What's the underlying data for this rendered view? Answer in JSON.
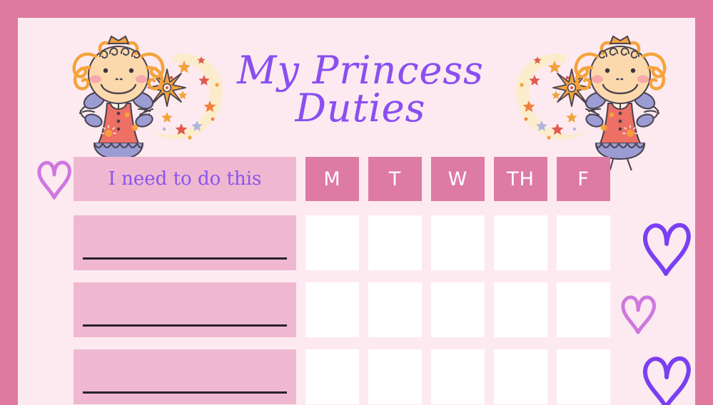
{
  "page": {
    "title_line1": "My Princess",
    "title_line2": "Duties",
    "border_color": "#e0799f",
    "background_color": "#fdeaf0"
  },
  "table": {
    "task_column_header": "I need to do this",
    "task_header_bg": "#efb8d0",
    "task_header_text_color": "#8855ee",
    "day_header_bg": "#dd7ba5",
    "day_header_text_color": "#ffffff",
    "row_bg": "#efb8d0",
    "cell_bg": "#ffffff",
    "day_headers": [
      {
        "label": "M"
      },
      {
        "label": "T"
      },
      {
        "label": "W"
      },
      {
        "label": "TH"
      },
      {
        "label": "F"
      }
    ],
    "rows": [
      {
        "task": "",
        "checks": [
          "",
          "",
          "",
          "",
          ""
        ]
      },
      {
        "task": "",
        "checks": [
          "",
          "",
          "",
          "",
          ""
        ]
      },
      {
        "task": "",
        "checks": [
          "",
          "",
          "",
          "",
          ""
        ]
      }
    ]
  },
  "decor": {
    "fairy_left": "fairy-with-wand-illustration",
    "fairy_right": "fairy-with-wand-illustration",
    "header_heart": "heart-outline-icon",
    "side_hearts": [
      {
        "name": "heart-outline-icon",
        "color": "#7b3ff2",
        "size": "large"
      },
      {
        "name": "heart-outline-icon",
        "color": "#cf77e0",
        "size": "small"
      },
      {
        "name": "heart-outline-icon",
        "color": "#7b3ff2",
        "size": "large"
      }
    ],
    "colors": {
      "title_purple": "#8a4ff0",
      "heart_purple": "#7b3ff2",
      "heart_pink": "#cf77e0",
      "hair_orange": "#f5a33c",
      "dress_coral": "#ee6f63",
      "wing_purple": "#9c9cd4",
      "sparkle_cream": "#fbeccb"
    }
  }
}
